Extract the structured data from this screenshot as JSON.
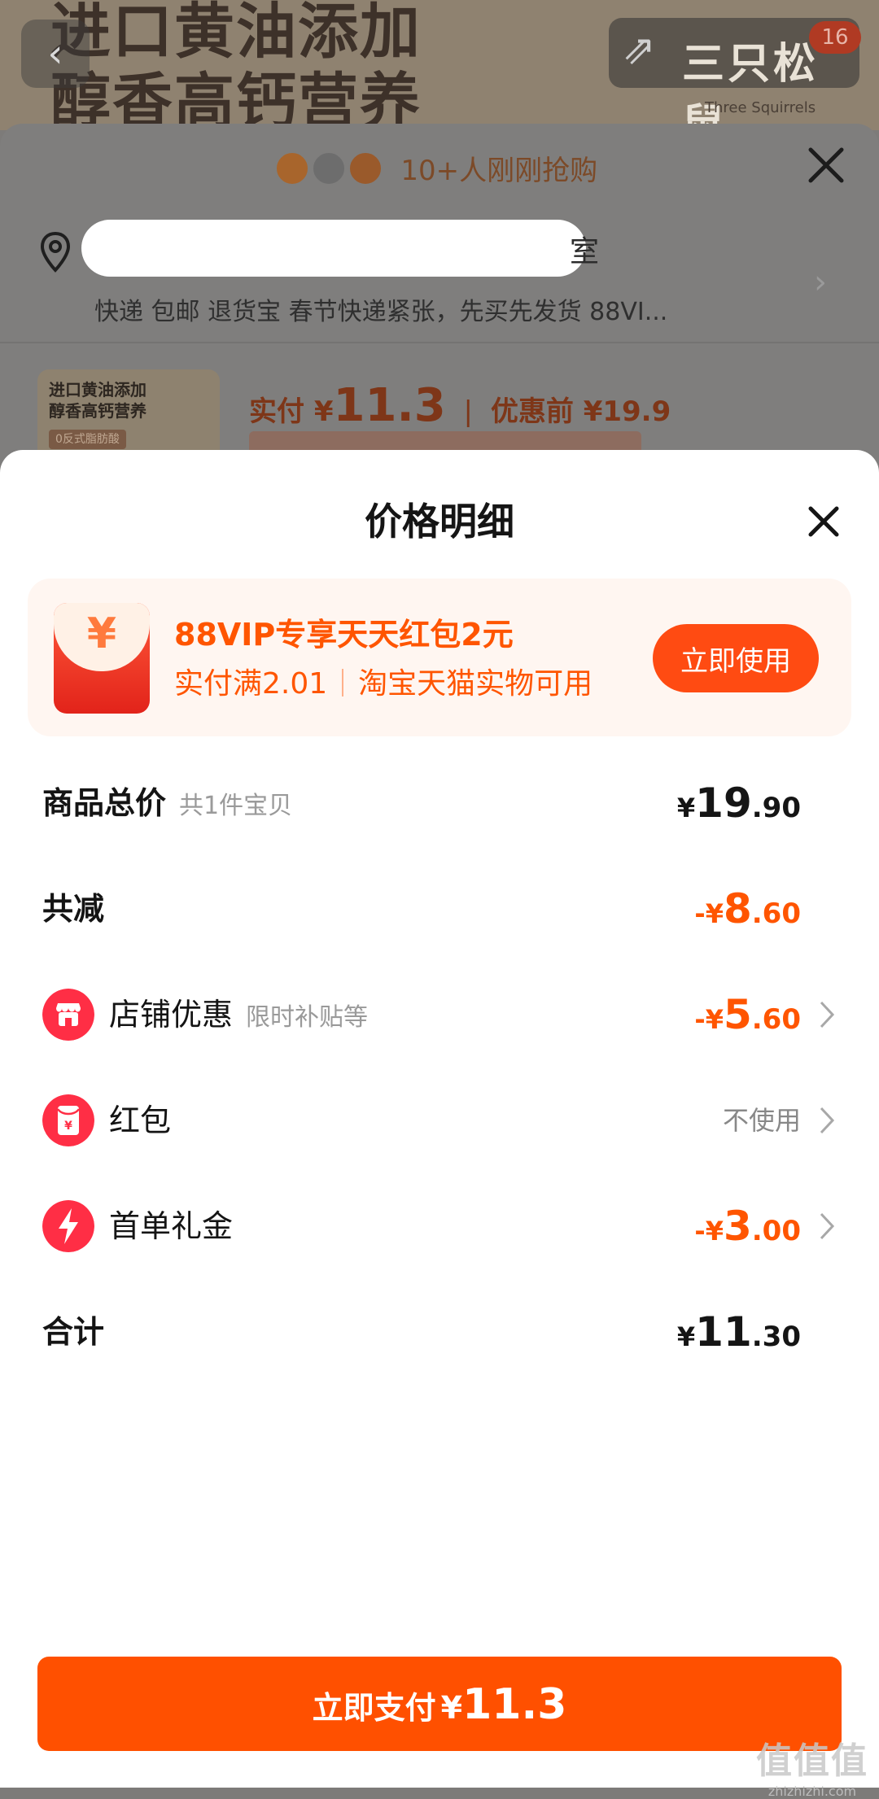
{
  "background": {
    "banner_text": "进口黄油添加\n醇香高钙营养",
    "back_icon": "chevron-left-icon",
    "share_icon": "share-arrow-icon",
    "brand_text": "三只松鼠",
    "brand_sub": "Three Squirrels",
    "cart_count": "16",
    "buyers_text": "10+人刚刚抢购",
    "address_visible_tail": "室",
    "delivery_text": "快递 包邮 退货宝 春节快递紧张，先买先发货 88VI...",
    "thumb_text": "进口黄油添加\n醇香高钙营养",
    "thumb_bar": "0反式脂肪酸",
    "price_actual_label": "实付",
    "price_actual_currency": "¥",
    "price_actual_value": "11.3",
    "price_before_label": "优惠前",
    "price_before_value": "¥19.9"
  },
  "sheet": {
    "title": "价格明细",
    "close_icon": "close-icon"
  },
  "promo": {
    "icon": "red-envelope-icon",
    "icon_glyph": "¥",
    "title": "88VIP专享天天红包2元",
    "condition": "实付满2.01",
    "scope": "淘宝天猫实物可用",
    "button": "立即使用"
  },
  "rows": {
    "subtotal": {
      "label": "商品总价",
      "hint": "共1件宝贝",
      "sign": "¥",
      "int": "19",
      "dec": ".90"
    },
    "discount_total": {
      "label": "共减",
      "sign": "-¥",
      "int": "8",
      "dec": ".60"
    },
    "shop_discount": {
      "icon": "store-icon",
      "label": "店铺优惠",
      "hint": "限时补贴等",
      "sign": "-¥",
      "int": "5",
      "dec": ".60"
    },
    "red_packet": {
      "icon": "red-envelope-icon",
      "label": "红包",
      "value": "不使用"
    },
    "first_order": {
      "icon": "lightning-icon",
      "label": "首单礼金",
      "sign": "-¥",
      "int": "3",
      "dec": ".00"
    },
    "total": {
      "label": "合计",
      "sign": "¥",
      "int": "11",
      "dec": ".30"
    }
  },
  "pay": {
    "label": "立即支付",
    "currency": "¥",
    "amount": "11.3"
  },
  "watermark": {
    "main": "值值值",
    "sub": "zhizhizhi.com"
  },
  "colors": {
    "accent": "#ff5000",
    "promo_bg": "#fff6f1",
    "icon_red": "#ff2e45"
  }
}
